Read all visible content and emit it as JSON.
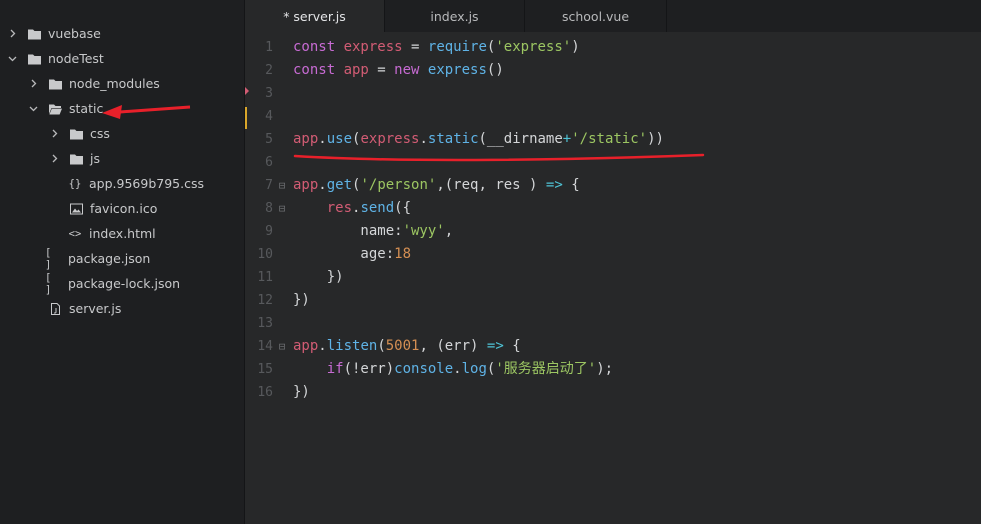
{
  "sidebar": {
    "items": [
      {
        "label": "vuebase",
        "icon": "folder-icon",
        "chevron": "right",
        "indent": 0
      },
      {
        "label": "nodeTest",
        "icon": "folder-icon",
        "chevron": "down",
        "indent": 0
      },
      {
        "label": "node_modules",
        "icon": "folder-icon",
        "chevron": "right",
        "indent": 1
      },
      {
        "label": "static",
        "icon": "folder-open-icon",
        "chevron": "down",
        "indent": 1
      },
      {
        "label": "css",
        "icon": "folder-icon",
        "chevron": "right",
        "indent": 2
      },
      {
        "label": "js",
        "icon": "folder-icon",
        "chevron": "right",
        "indent": 2
      },
      {
        "label": "app.9569b795.css",
        "icon": "css-file-icon",
        "glyph": "{}",
        "chevron": "none",
        "indent": 2
      },
      {
        "label": "favicon.ico",
        "icon": "image-file-icon",
        "chevron": "none",
        "indent": 2
      },
      {
        "label": "index.html",
        "icon": "html-file-icon",
        "glyph": "<>",
        "chevron": "none",
        "indent": 2
      },
      {
        "label": "package.json",
        "icon": "json-file-icon",
        "glyph": "[ ]",
        "chevron": "none",
        "indent": 1
      },
      {
        "label": "package-lock.json",
        "icon": "json-file-icon",
        "glyph": "[ ]",
        "chevron": "none",
        "indent": 1
      },
      {
        "label": "server.js",
        "icon": "js-file-icon",
        "chevron": "none",
        "indent": 1
      }
    ]
  },
  "tabs": [
    {
      "label": "* server.js",
      "active": true
    },
    {
      "label": "index.js",
      "active": false
    },
    {
      "label": "school.vue",
      "active": false
    }
  ],
  "colors": {
    "underline": "#e8202a",
    "arrow": "#e8202a",
    "modified_marker": "#d9a62a",
    "git_marker": "#d25c74"
  },
  "lines": [
    {
      "n": "1",
      "fold": "",
      "tokens": [
        [
          "k",
          "const "
        ],
        [
          "id",
          "express"
        ],
        [
          "p",
          " = "
        ],
        [
          "f",
          "require"
        ],
        [
          "p",
          "("
        ],
        [
          "s",
          "'express'"
        ],
        [
          "p",
          ")"
        ]
      ]
    },
    {
      "n": "2",
      "fold": "",
      "tokens": [
        [
          "k",
          "const "
        ],
        [
          "id",
          "app"
        ],
        [
          "p",
          " = "
        ],
        [
          "k",
          "new "
        ],
        [
          "f",
          "express"
        ],
        [
          "p",
          "()"
        ]
      ]
    },
    {
      "n": "3",
      "fold": "",
      "tokens": []
    },
    {
      "n": "4",
      "fold": "",
      "tokens": []
    },
    {
      "n": "5",
      "fold": "",
      "tokens": [
        [
          "id",
          "app"
        ],
        [
          "p",
          "."
        ],
        [
          "f",
          "use"
        ],
        [
          "p",
          "("
        ],
        [
          "id",
          "express"
        ],
        [
          "p",
          "."
        ],
        [
          "f",
          "static"
        ],
        [
          "p",
          "(__dirname"
        ],
        [
          "o",
          "+"
        ],
        [
          "s",
          "'/static'"
        ],
        [
          "p",
          "))"
        ]
      ]
    },
    {
      "n": "6",
      "fold": "",
      "tokens": []
    },
    {
      "n": "7",
      "fold": "⊟",
      "tokens": [
        [
          "id",
          "app"
        ],
        [
          "p",
          "."
        ],
        [
          "f",
          "get"
        ],
        [
          "p",
          "("
        ],
        [
          "s",
          "'/person'"
        ],
        [
          "p",
          ",(req, res ) "
        ],
        [
          "o",
          "=>"
        ],
        [
          "p",
          " {"
        ]
      ]
    },
    {
      "n": "8",
      "fold": "⊟",
      "tokens": [
        [
          "p",
          "    "
        ],
        [
          "id",
          "res"
        ],
        [
          "p",
          "."
        ],
        [
          "f",
          "send"
        ],
        [
          "p",
          "({"
        ]
      ]
    },
    {
      "n": "9",
      "fold": "",
      "tokens": [
        [
          "p",
          "        name:"
        ],
        [
          "s",
          "'wyy'"
        ],
        [
          "p",
          ","
        ]
      ]
    },
    {
      "n": "10",
      "fold": "",
      "tokens": [
        [
          "p",
          "        age:"
        ],
        [
          "n",
          "18"
        ]
      ]
    },
    {
      "n": "11",
      "fold": "",
      "tokens": [
        [
          "p",
          "    })"
        ]
      ]
    },
    {
      "n": "12",
      "fold": "",
      "tokens": [
        [
          "p",
          "})"
        ]
      ]
    },
    {
      "n": "13",
      "fold": "",
      "tokens": []
    },
    {
      "n": "14",
      "fold": "⊟",
      "tokens": [
        [
          "id",
          "app"
        ],
        [
          "p",
          "."
        ],
        [
          "f",
          "listen"
        ],
        [
          "p",
          "("
        ],
        [
          "n",
          "5001"
        ],
        [
          "p",
          ", (err) "
        ],
        [
          "o",
          "=>"
        ],
        [
          "p",
          " {"
        ]
      ]
    },
    {
      "n": "15",
      "fold": "",
      "tokens": [
        [
          "p",
          "    "
        ],
        [
          "k",
          "if"
        ],
        [
          "p",
          "(!err)"
        ],
        [
          "f",
          "console"
        ],
        [
          "p",
          "."
        ],
        [
          "f",
          "log"
        ],
        [
          "p",
          "("
        ],
        [
          "s",
          "'服务器启动了'"
        ],
        [
          "p",
          ");"
        ]
      ]
    },
    {
      "n": "16",
      "fold": "",
      "tokens": [
        [
          "p",
          "})"
        ]
      ]
    }
  ]
}
